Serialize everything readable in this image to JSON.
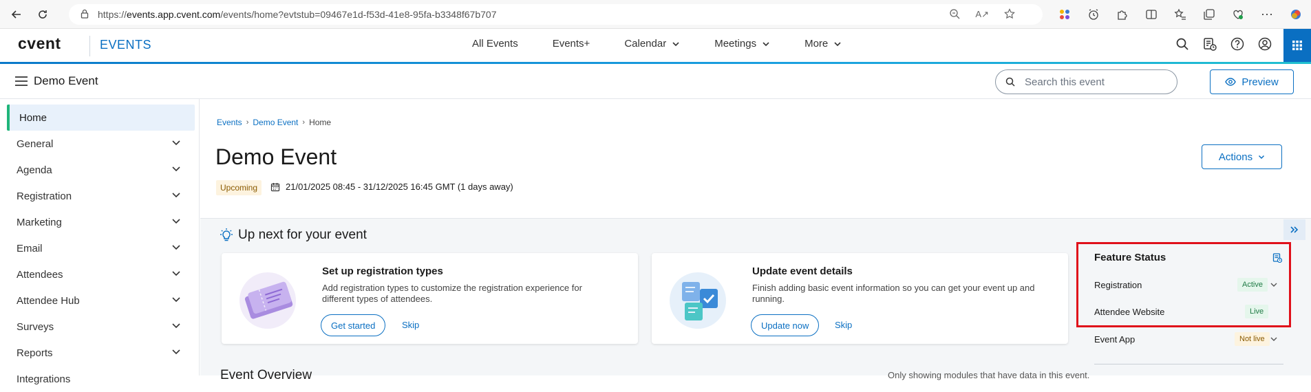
{
  "browser": {
    "url_prefix": "https://",
    "url_host": "events.app.cvent.com",
    "url_path": "/events/home?evtstub=09467e1d-f53d-41e8-95fa-b3348f67b707"
  },
  "app": {
    "logo": "cvent",
    "name": "EVENTS",
    "nav": [
      "All Events",
      "Events+",
      "Calendar",
      "Meetings",
      "More"
    ]
  },
  "subheader": {
    "event_name": "Demo Event",
    "search_placeholder": "Search this event",
    "preview_label": "Preview"
  },
  "sidebar": {
    "items": [
      {
        "label": "Home",
        "active": true
      },
      {
        "label": "General"
      },
      {
        "label": "Agenda"
      },
      {
        "label": "Registration"
      },
      {
        "label": "Marketing"
      },
      {
        "label": "Email"
      },
      {
        "label": "Attendees"
      },
      {
        "label": "Attendee Hub"
      },
      {
        "label": "Surveys"
      },
      {
        "label": "Reports"
      },
      {
        "label": "Integrations"
      }
    ]
  },
  "breadcrumb": {
    "items": [
      "Events",
      "Demo Event"
    ],
    "current": "Home"
  },
  "page": {
    "title": "Demo Event",
    "status": "Upcoming",
    "dates": "21/01/2025 08:45 - 31/12/2025 16:45 GMT (1 days away)",
    "actions_label": "Actions"
  },
  "upnext": {
    "title": "Up next for your event",
    "cards": [
      {
        "title": "Set up registration types",
        "desc": "Add registration types to customize the registration experience for different types of attendees.",
        "primary": "Get started",
        "skip": "Skip"
      },
      {
        "title": "Update event details",
        "desc": "Finish adding basic event information so you can get your event up and running.",
        "primary": "Update now",
        "skip": "Skip"
      }
    ]
  },
  "feature_status": {
    "title": "Feature Status",
    "rows": [
      {
        "label": "Registration",
        "status": "Active"
      },
      {
        "label": "Attendee Website",
        "status": "Live"
      },
      {
        "label": "Event App",
        "status": "Not live"
      }
    ]
  },
  "overview": {
    "title": "Event Overview",
    "note": "Only showing modules that have data in this event."
  },
  "colors": {
    "accent": "#0a6fc2",
    "active_indicator": "#1fb57a",
    "highlight_box": "#e0101a"
  }
}
